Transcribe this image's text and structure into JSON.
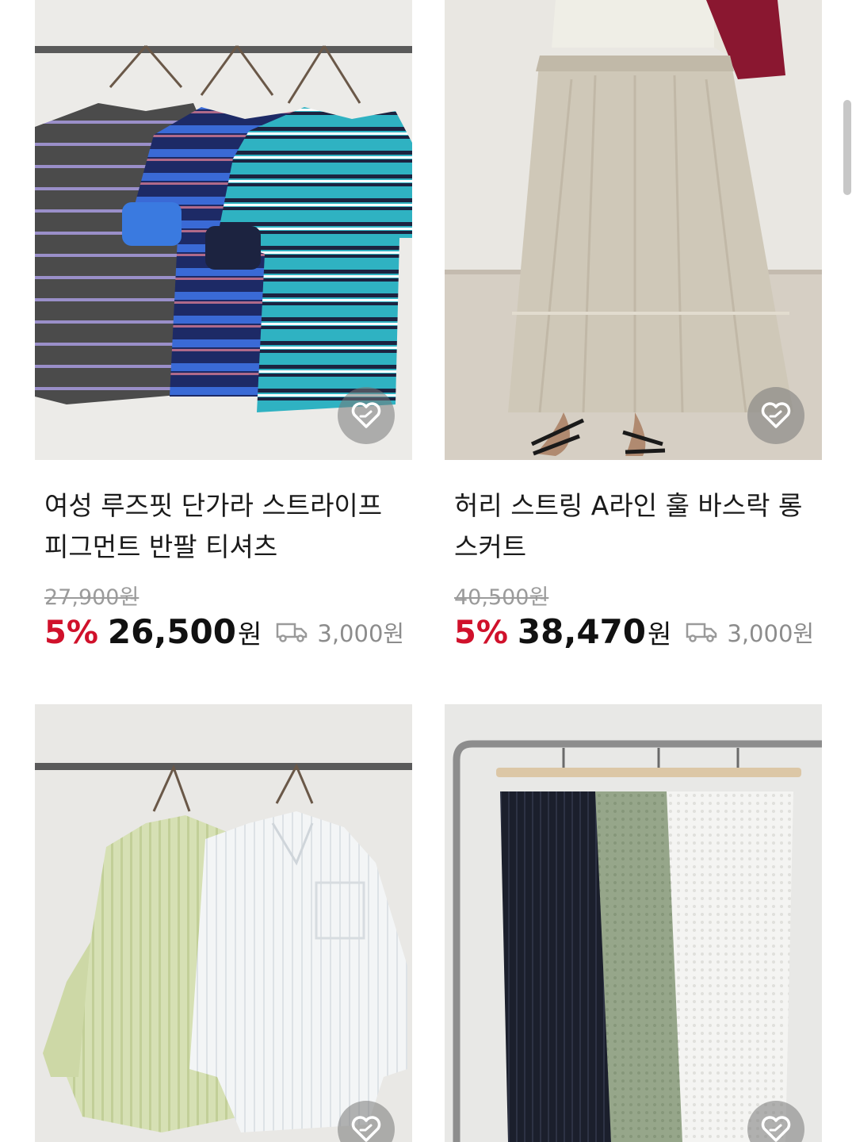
{
  "products": [
    {
      "title": "여성 루즈핏 단가라 스트라이프 피그먼트 반팔 티셔츠",
      "original_price": "27,900원",
      "discount": "5%",
      "price": "26,500",
      "currency": "원",
      "shipping": "3,000원",
      "image": "striped-tshirts-photo",
      "wishlist_icon": "heart-icon"
    },
    {
      "title": "허리 스트링 A라인 훌 바스락 롱 스커트",
      "original_price": "40,500원",
      "discount": "5%",
      "price": "38,470",
      "currency": "원",
      "shipping": "3,000원",
      "image": "long-skirt-photo",
      "wishlist_icon": "heart-icon"
    },
    {
      "image": "striped-shirts-photo",
      "wishlist_icon": "heart-icon"
    },
    {
      "image": "textured-pants-photo",
      "wishlist_icon": "heart-icon"
    }
  ],
  "colors": {
    "discount": "#d0112b",
    "strike_price": "#9b9b9b",
    "shipping_text": "#8c8c8c"
  },
  "icons": {
    "shipping": "truck-icon"
  }
}
